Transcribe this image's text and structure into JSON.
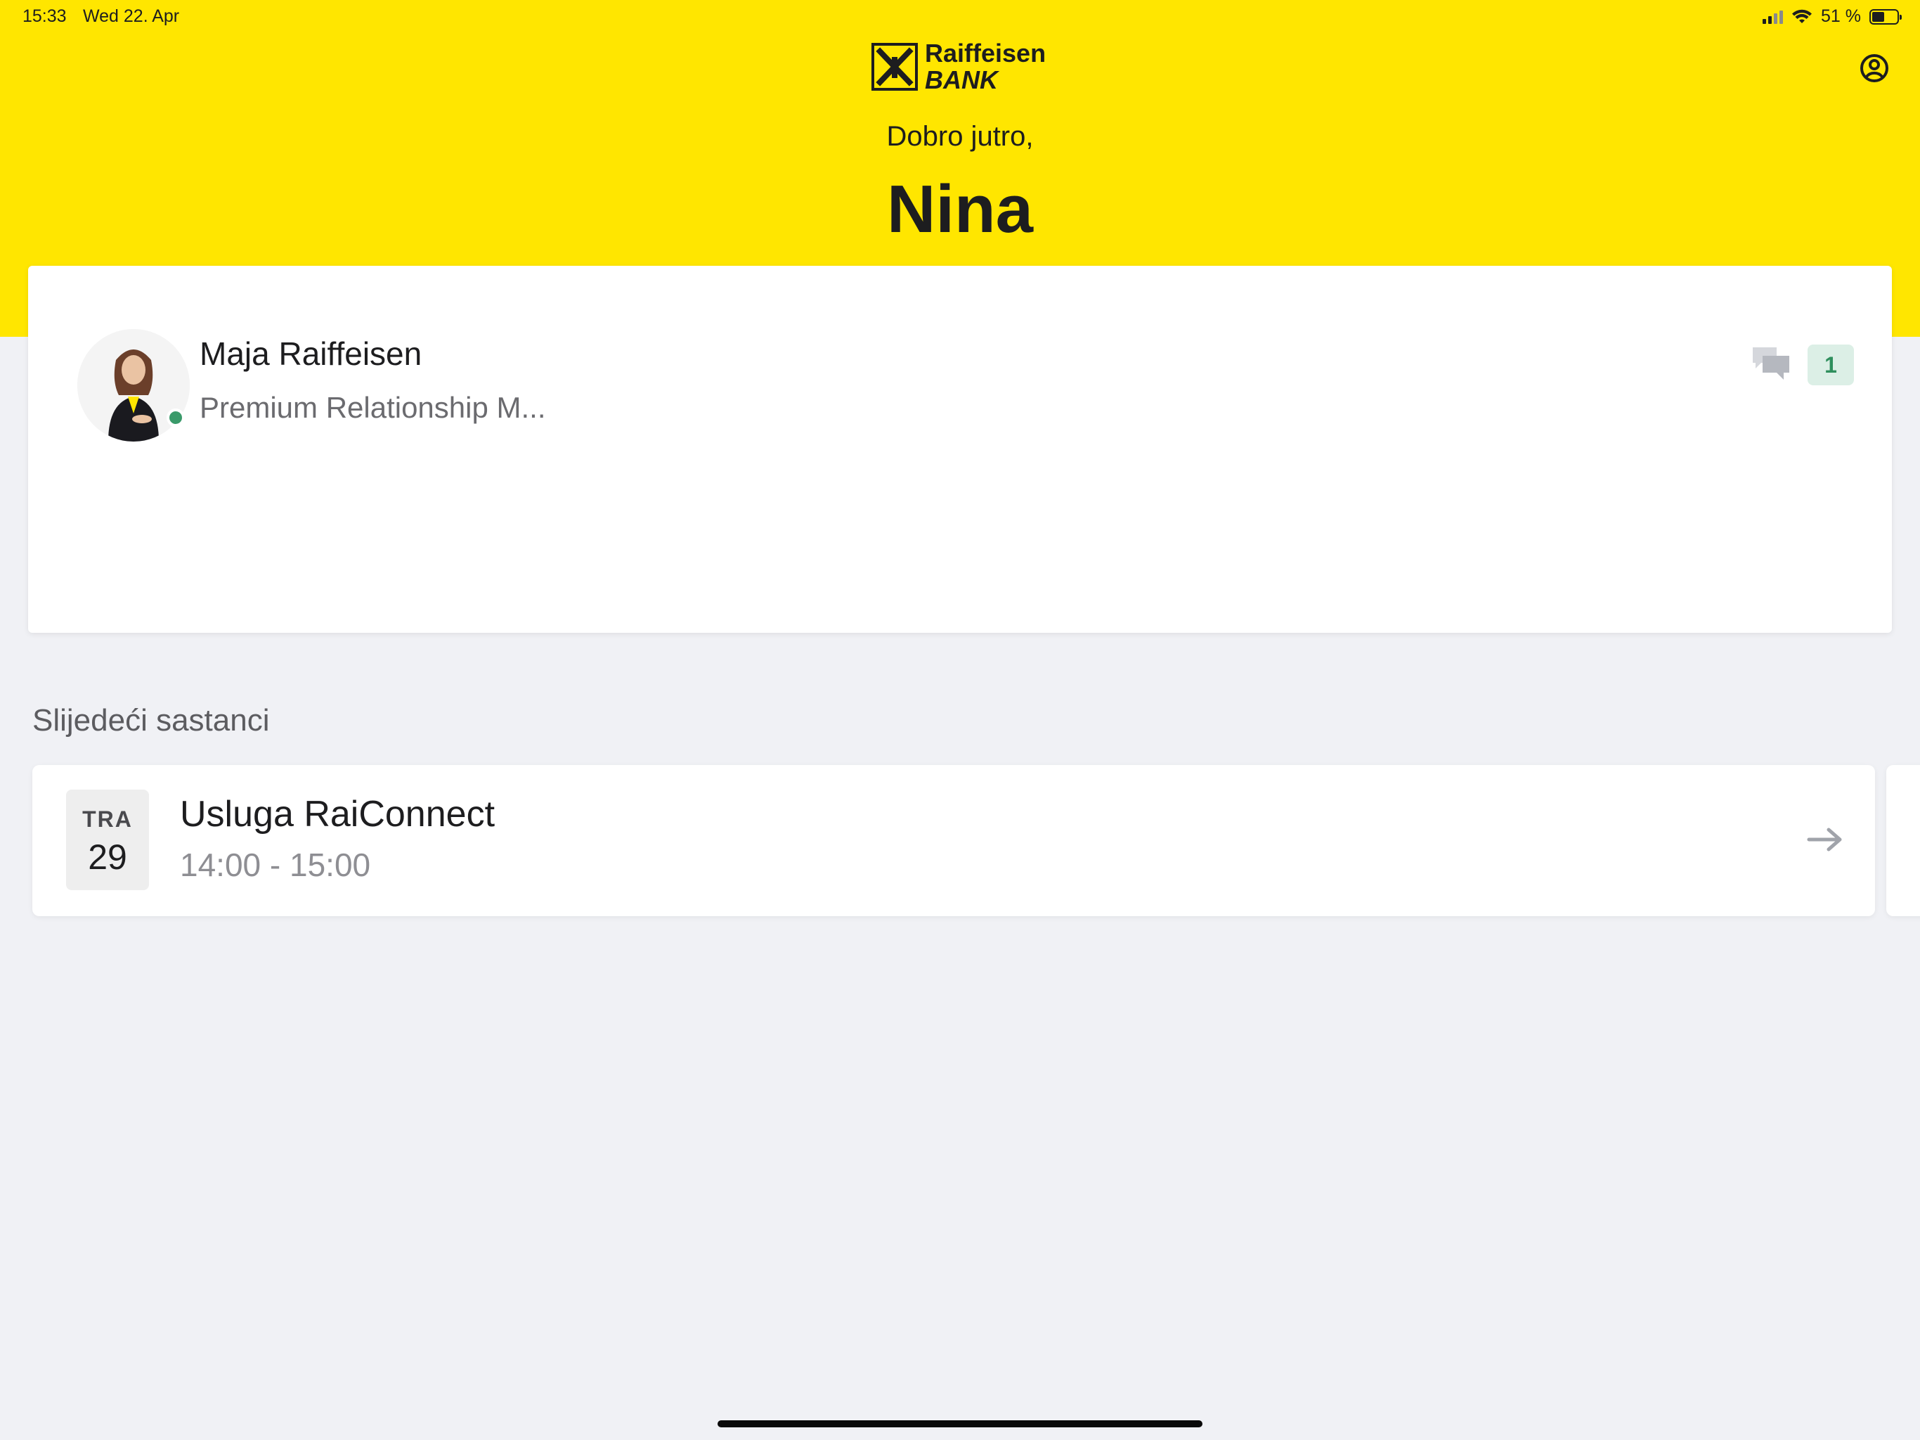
{
  "status_bar": {
    "time": "15:33",
    "date": "Wed 22. Apr",
    "battery": "51 %",
    "battery_level": 0.51
  },
  "header": {
    "logo_line1": "Raiffeisen",
    "logo_line2": "BANK",
    "greeting": "Dobro jutro,",
    "user_name": "Nina",
    "background_color": "#ffe600",
    "profile_icon": "user-circle-icon"
  },
  "relationship_manager": {
    "name": "Maja Raiffeisen",
    "role": "Premium Relationship M...",
    "status": "online",
    "chat_icon": "chat-bubbles-icon",
    "unread_count": "1"
  },
  "meetings": {
    "section_title": "Slijedeći sastanci",
    "items": [
      {
        "month": "TRA",
        "day": "29",
        "title": "Usluga RaiConnect",
        "time": "14:00 - 15:00",
        "action_icon": "arrow-right-icon"
      }
    ]
  }
}
